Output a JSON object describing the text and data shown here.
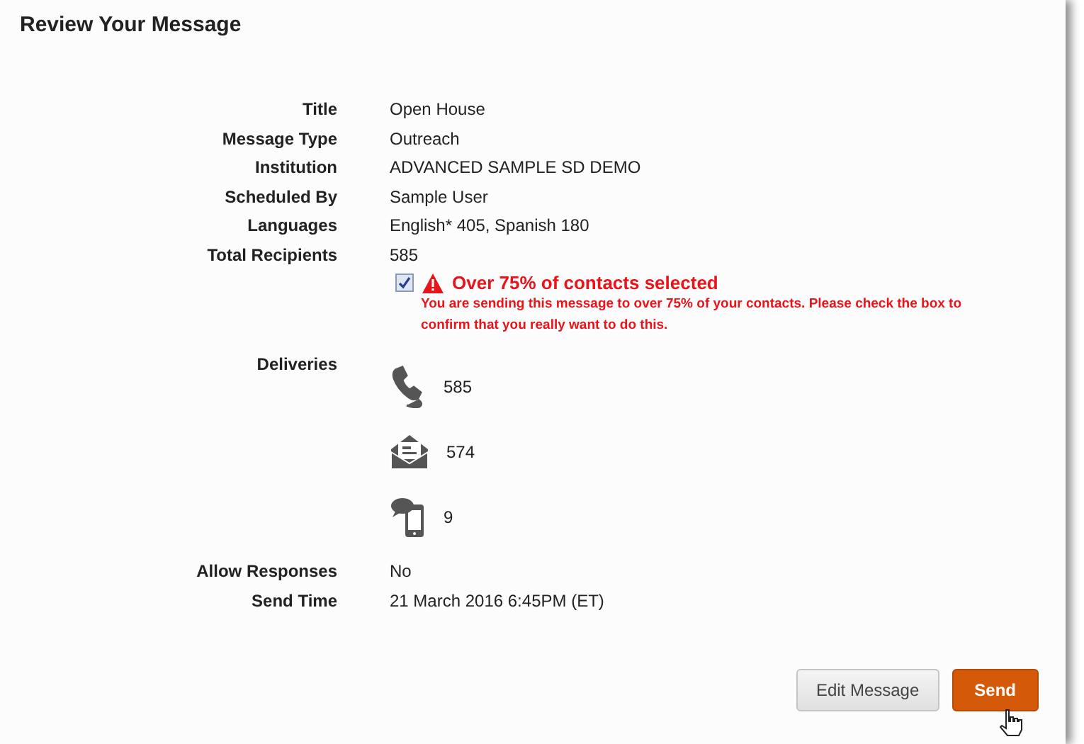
{
  "heading": "Review Your Message",
  "fields": [
    {
      "label": "Title",
      "value": "Open House"
    },
    {
      "label": "Message Type",
      "value": "Outreach"
    },
    {
      "label": "Institution",
      "value": "ADVANCED SAMPLE SD DEMO"
    },
    {
      "label": "Scheduled By",
      "value": "Sample User"
    },
    {
      "label": "Languages",
      "value": "English* 405, Spanish 180"
    },
    {
      "label": "Total Recipients",
      "value": "585"
    }
  ],
  "warning": {
    "checked": true,
    "title": "Over 75% of contacts selected",
    "message": "You are sending this message to over 75% of your contacts. Please check the box to confirm that you really want to do this."
  },
  "deliveries": {
    "label": "Deliveries",
    "items": [
      {
        "kind": "phone",
        "count": "585"
      },
      {
        "kind": "email",
        "count": "574"
      },
      {
        "kind": "sms",
        "count": "9"
      }
    ]
  },
  "footer_fields": [
    {
      "label": "Allow Responses",
      "value": "No"
    },
    {
      "label": "Send Time",
      "value": "21 March 2016 6:45PM (ET)"
    }
  ],
  "buttons": [
    {
      "label": "Edit Message",
      "kind": "secondary"
    },
    {
      "label": "Send",
      "kind": "primary"
    }
  ]
}
